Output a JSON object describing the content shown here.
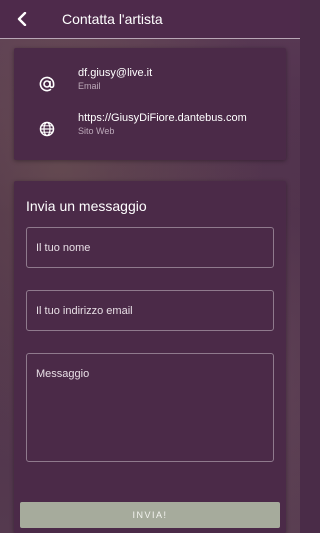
{
  "header": {
    "title": "Contatta l'artista",
    "back_icon": "back-arrow-icon"
  },
  "contacts": [
    {
      "icon": "at-icon",
      "value": "df.giusy@live.it",
      "label": "Email"
    },
    {
      "icon": "globe-icon",
      "value": "https://GiusyDiFiore.dantebus.com",
      "label": "Sito Web"
    }
  ],
  "message_form": {
    "title": "Invia un messaggio",
    "name_placeholder": "Il tuo nome",
    "email_placeholder": "Il tuo indirizzo email",
    "message_placeholder": "Messaggio",
    "send_label": "INVIA!"
  },
  "colors": {
    "primary": "#4e2a4b",
    "card": "#4b2a48",
    "button": "#a6ab9c"
  }
}
